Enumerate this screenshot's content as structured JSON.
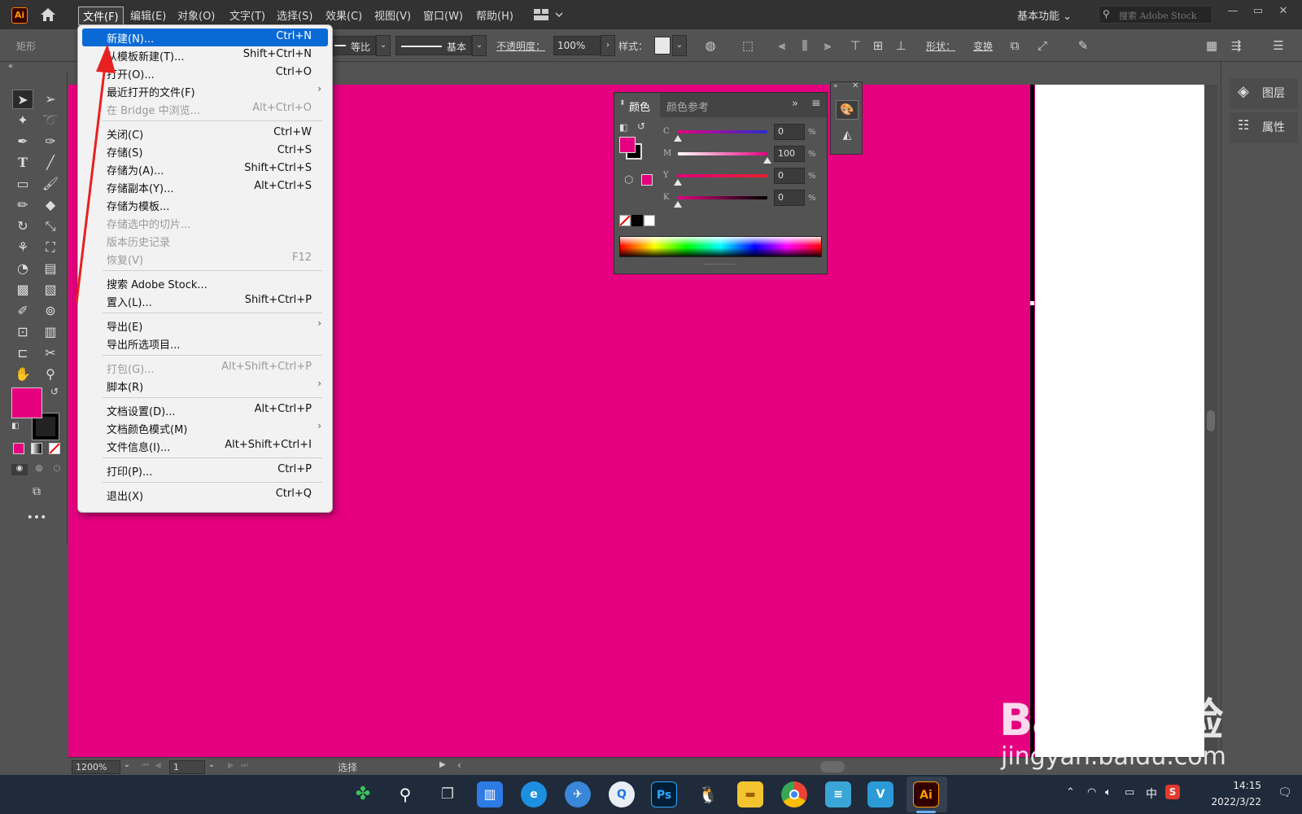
{
  "app": {
    "logo_text": "Ai"
  },
  "menubar": {
    "items": [
      "文件(F)",
      "编辑(E)",
      "对象(O)",
      "文字(T)",
      "选择(S)",
      "效果(C)",
      "视图(V)",
      "窗口(W)",
      "帮助(H)"
    ],
    "workspace": "基本功能",
    "search_placeholder": "搜索 Adobe Stock"
  },
  "controlbar": {
    "object_type": "矩形",
    "stroke_profile": "等比",
    "brush": "基本",
    "opacity_label": "不透明度：",
    "opacity_value": "100%",
    "style_label": "样式：",
    "shape_label": "形状：",
    "transform_label": "变换"
  },
  "file_menu": {
    "items": [
      {
        "label": "新建(N)...",
        "shortcut": "Ctrl+N",
        "state": "highlighted"
      },
      {
        "label": "从模板新建(T)...",
        "shortcut": "Shift+Ctrl+N"
      },
      {
        "label": "打开(O)...",
        "shortcut": "Ctrl+O"
      },
      {
        "label": "最近打开的文件(F)",
        "submenu": true
      },
      {
        "label": "在 Bridge 中浏览...",
        "shortcut": "Alt+Ctrl+O",
        "state": "disabled"
      },
      {
        "separator": true
      },
      {
        "label": "关闭(C)",
        "shortcut": "Ctrl+W"
      },
      {
        "label": "存储(S)",
        "shortcut": "Ctrl+S"
      },
      {
        "label": "存储为(A)...",
        "shortcut": "Shift+Ctrl+S"
      },
      {
        "label": "存储副本(Y)...",
        "shortcut": "Alt+Ctrl+S"
      },
      {
        "label": "存储为模板..."
      },
      {
        "label": "存储选中的切片...",
        "state": "disabled"
      },
      {
        "label": "版本历史记录",
        "state": "disabled"
      },
      {
        "label": "恢复(V)",
        "shortcut": "F12",
        "state": "disabled"
      },
      {
        "separator": true
      },
      {
        "label": "搜索 Adobe Stock..."
      },
      {
        "label": "置入(L)...",
        "shortcut": "Shift+Ctrl+P"
      },
      {
        "separator": true
      },
      {
        "label": "导出(E)",
        "submenu": true
      },
      {
        "label": "导出所选项目..."
      },
      {
        "separator": true
      },
      {
        "label": "打包(G)...",
        "shortcut": "Alt+Shift+Ctrl+P",
        "state": "disabled"
      },
      {
        "label": "脚本(R)",
        "submenu": true
      },
      {
        "separator": true
      },
      {
        "label": "文档设置(D)...",
        "shortcut": "Alt+Ctrl+P"
      },
      {
        "label": "文档颜色模式(M)",
        "submenu": true
      },
      {
        "label": "文件信息(I)...",
        "shortcut": "Alt+Shift+Ctrl+I"
      },
      {
        "separator": true
      },
      {
        "label": "打印(P)...",
        "shortcut": "Ctrl+P"
      },
      {
        "separator": true
      },
      {
        "label": "退出(X)",
        "shortcut": "Ctrl+Q"
      }
    ]
  },
  "color_panel": {
    "tabs": [
      "颜色",
      "颜色参考"
    ],
    "fill_color": "#e4007f",
    "sliders": [
      {
        "label": "C",
        "value": "0",
        "level": 0
      },
      {
        "label": "M",
        "value": "100",
        "level": 1
      },
      {
        "label": "Y",
        "value": "0",
        "level": 0
      },
      {
        "label": "K",
        "value": "0",
        "level": 0
      }
    ],
    "percent_sign": "%"
  },
  "right_panel": {
    "items": [
      "图层",
      "属性"
    ]
  },
  "statusbar": {
    "zoom": "1200%",
    "artboard": "1",
    "tool_name": "选择"
  },
  "canvas": {
    "fill_color": "#e4007f"
  },
  "taskbar": {
    "time": "14:15",
    "date": "2022/3/22",
    "ime": "中",
    "ps_label": "Ps",
    "ai_label": "Ai"
  },
  "watermark": {
    "brand": "Baidu经验",
    "url": "jingyan.baidu.com"
  }
}
